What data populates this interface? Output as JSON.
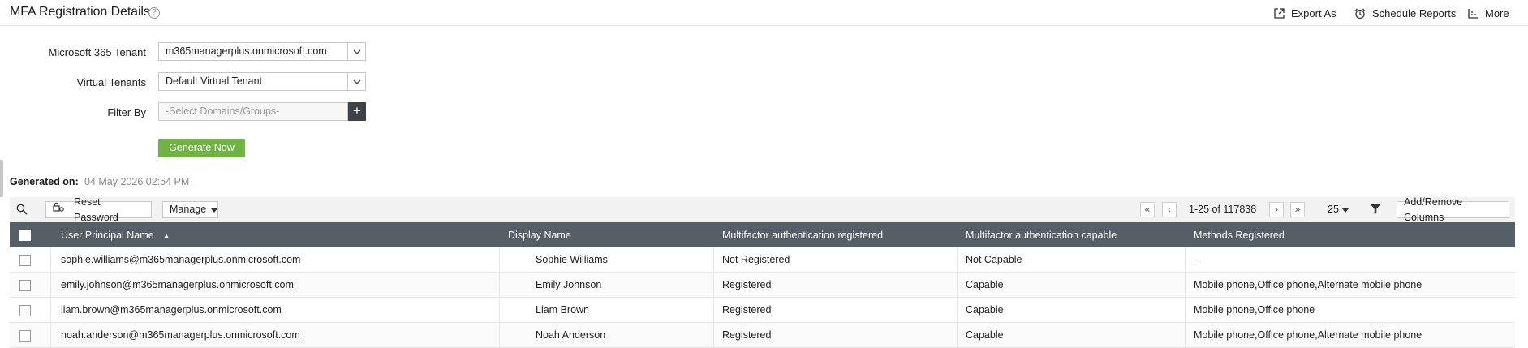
{
  "header": {
    "title": "MFA Registration Details",
    "help_icon": "?",
    "actions": {
      "export": "Export As",
      "schedule": "Schedule Reports",
      "more": "More"
    }
  },
  "form": {
    "tenant_label": "Microsoft 365 Tenant",
    "tenant_value": "m365managerplus.onmicrosoft.com",
    "virtual_label": "Virtual Tenants",
    "virtual_value": "Default Virtual Tenant",
    "filter_label": "Filter By",
    "filter_placeholder": "-Select Domains/Groups-",
    "plus": "+",
    "generate_label": "Generate Now"
  },
  "generated": {
    "label": "Generated on:",
    "value": "04 May 2026 02:54 PM"
  },
  "toolbar": {
    "reset_password": "Reset Password",
    "manage": "Manage",
    "first": "«",
    "prev": "‹",
    "range": "1-25 of 117838",
    "next": "›",
    "last": "»",
    "page_size": "25",
    "add_remove_columns": "Add/Remove Columns"
  },
  "table": {
    "columns": {
      "upn": "User Principal Name",
      "display_name": "Display Name",
      "mfa_registered": "Multifactor authentication registered",
      "mfa_capable": "Multifactor authentication capable",
      "methods": "Methods Registered"
    },
    "sort_indicator": "▲",
    "rows": [
      {
        "upn": "sophie.williams@m365managerplus.onmicrosoft.com",
        "display_name": "Sophie Williams",
        "mfa_registered": "Not Registered",
        "mfa_capable": "Not Capable",
        "methods": "-"
      },
      {
        "upn": "emily.johnson@m365managerplus.onmicrosoft.com",
        "display_name": "Emily Johnson",
        "mfa_registered": "Registered",
        "mfa_capable": "Capable",
        "methods": "Mobile phone,Office phone,Alternate mobile phone"
      },
      {
        "upn": "liam.brown@m365managerplus.onmicrosoft.com",
        "display_name": "Liam Brown",
        "mfa_registered": "Registered",
        "mfa_capable": "Capable",
        "methods": "Mobile phone,Office phone"
      },
      {
        "upn": "noah.anderson@m365managerplus.onmicrosoft.com",
        "display_name": "Noah Anderson",
        "mfa_registered": "Registered",
        "mfa_capable": "Capable",
        "methods": "Mobile phone,Office phone,Alternate mobile phone"
      }
    ]
  },
  "colors": {
    "header_bg": "#565f66",
    "generate_button": "#6fb342",
    "plus_button": "#3d4248"
  }
}
